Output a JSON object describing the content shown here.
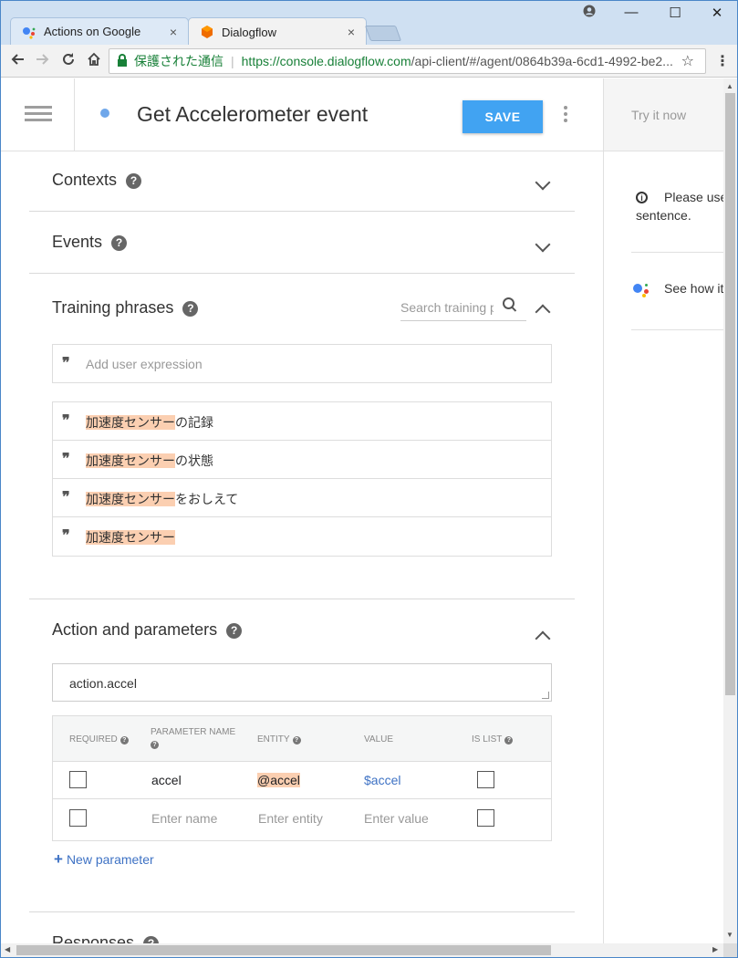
{
  "browser": {
    "tabs": [
      {
        "label": "Actions on Google",
        "close": "×"
      },
      {
        "label": "Dialogflow",
        "close": "×"
      }
    ],
    "secure_label": "保護された通信",
    "url_host": "https://console.dialogflow.com",
    "url_path": "/api-client/#/agent/0864b39a-6cd1-4992-be2...",
    "window_controls": {
      "minimize": "—",
      "maximize": "☐",
      "close": "✕"
    }
  },
  "header": {
    "intent_title": "Get Accelerometer event",
    "save_label": "SAVE"
  },
  "sections": {
    "contexts": "Contexts",
    "events": "Events",
    "training": "Training phrases",
    "action": "Action and parameters",
    "responses": "Responses"
  },
  "help_glyph": "?",
  "training": {
    "search_placeholder": "Search training p",
    "add_placeholder": "Add user expression",
    "phrases": [
      {
        "entity": "加速度センサー",
        "rest": "の記録"
      },
      {
        "entity": "加速度センサー",
        "rest": "の状態"
      },
      {
        "entity": "加速度センサー",
        "rest": "をおしえて"
      },
      {
        "entity": "加速度センサー",
        "rest": ""
      }
    ]
  },
  "action": {
    "value": "action.accel",
    "table": {
      "headers": {
        "required": "REQUIRED",
        "parameter_name": "PARAMETER NAME",
        "entity": "ENTITY",
        "value": "VALUE",
        "is_list": "IS LIST"
      },
      "rows": [
        {
          "name": "accel",
          "entity": "@accel",
          "value": "$accel"
        }
      ],
      "placeholders": {
        "name": "Enter name",
        "entity": "Enter entity",
        "value": "Enter value"
      }
    },
    "new_parameter": "New parameter"
  },
  "try_panel": {
    "title": "Try it now",
    "info_text": "Please use",
    "info_text2": "sentence.",
    "see_how": "See how it"
  },
  "colors": {
    "accent": "#41a3f2",
    "entity_highlight": "#fbcfb1",
    "link_blue": "#3e72c4",
    "secure_green": "#188038"
  }
}
